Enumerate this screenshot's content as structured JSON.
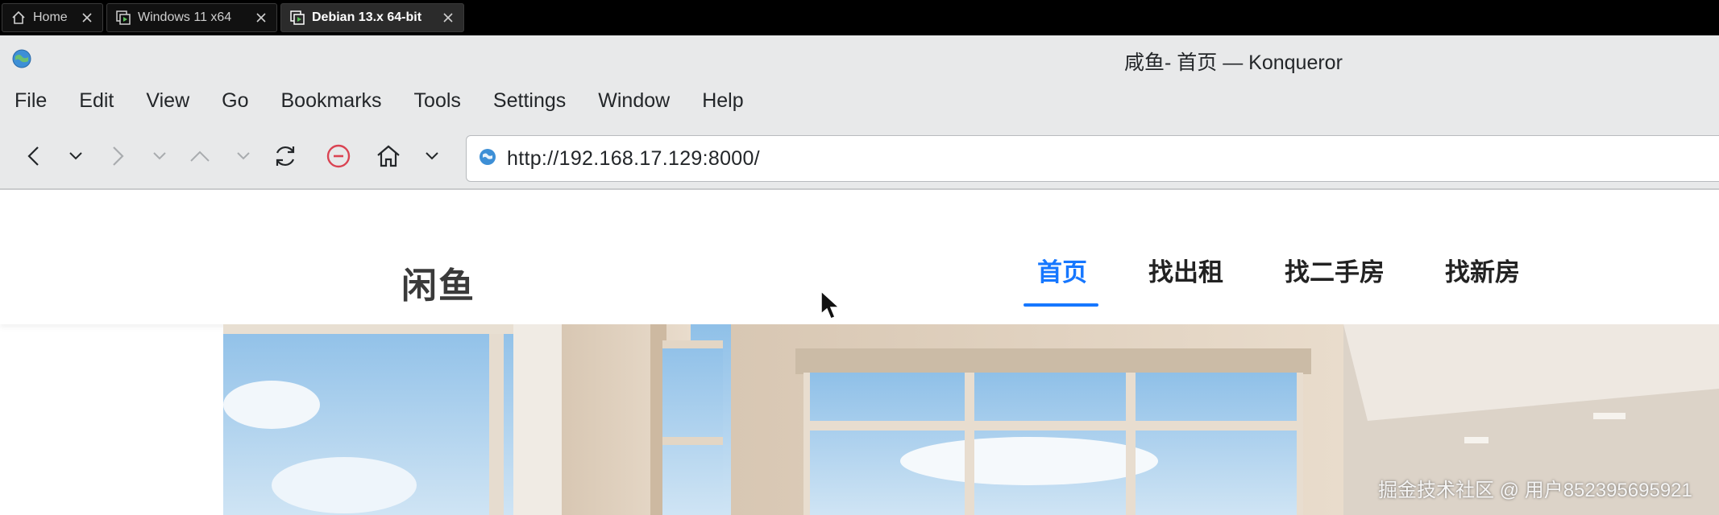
{
  "vm_tabs": [
    {
      "label": "Home",
      "icon": "home-icon"
    },
    {
      "label": "Windows 11 x64",
      "icon": "vm-running-icon"
    },
    {
      "label": "Debian 13.x 64-bit",
      "icon": "vm-running-icon",
      "active": true
    }
  ],
  "window": {
    "title": "咸鱼- 首页 — Konqueror",
    "app_icon": "konqueror-globe-icon"
  },
  "menu": [
    "File",
    "Edit",
    "View",
    "Go",
    "Bookmarks",
    "Tools",
    "Settings",
    "Window",
    "Help"
  ],
  "toolbar": {
    "buttons": [
      "back",
      "back-history",
      "forward",
      "forward-history",
      "up",
      "up-history",
      "reload",
      "stop",
      "home",
      "home-menu"
    ],
    "url": "http://192.168.17.129:8000/"
  },
  "site": {
    "logo": "闲鱼",
    "nav": [
      {
        "label": "首页",
        "active": true
      },
      {
        "label": "找出租"
      },
      {
        "label": "找二手房"
      },
      {
        "label": "找新房"
      }
    ],
    "accent": "#1677ff"
  },
  "watermark": "掘金技术社区 @ 用户852395695921"
}
